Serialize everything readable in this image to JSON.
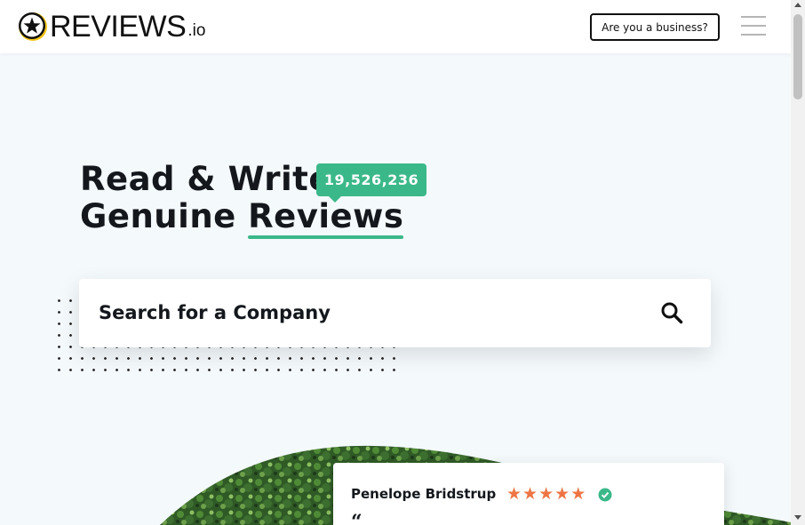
{
  "header": {
    "logo": {
      "text": "REVIEWS",
      "suffix": ".io"
    },
    "business_button": "Are you a business?",
    "menu_icon": "hamburger-menu-icon"
  },
  "hero": {
    "line1": "Read & Write",
    "line2_prefix": "Genuine ",
    "line2_highlight": "Reviews",
    "review_count": "19,526,236"
  },
  "search": {
    "placeholder": "Search for a Company",
    "icon": "search-icon"
  },
  "review_card": {
    "reviewer_name": "Penelope Bridstrup",
    "rating": 5,
    "max_rating": 5,
    "verified_icon": "verified-check-icon",
    "quote_mark": "“"
  },
  "colors": {
    "accent": "#3bb889",
    "star": "#ee7545",
    "text": "#14181d",
    "background": "#f4f9fc"
  }
}
